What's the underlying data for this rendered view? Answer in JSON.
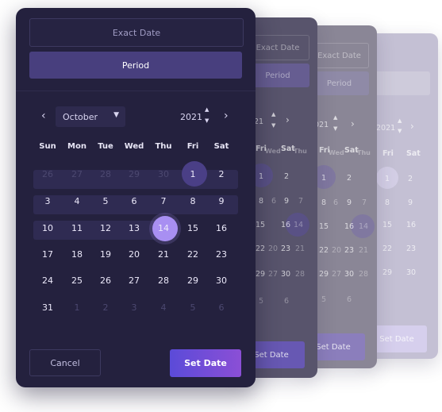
{
  "picker": {
    "tabs": {
      "exact": "Exact Date",
      "period": "Period"
    },
    "month": "October",
    "year": "2021",
    "weekdays": [
      "Sun",
      "Mon",
      "Tue",
      "Wed",
      "Thu",
      "Fri",
      "Sat"
    ],
    "weeks": [
      [
        "26",
        "27",
        "28",
        "29",
        "30",
        "1",
        "2"
      ],
      [
        "3",
        "4",
        "5",
        "6",
        "7",
        "8",
        "9"
      ],
      [
        "10",
        "11",
        "12",
        "13",
        "14",
        "15",
        "16"
      ],
      [
        "17",
        "18",
        "19",
        "20",
        "21",
        "22",
        "23"
      ],
      [
        "24",
        "25",
        "26",
        "27",
        "28",
        "29",
        "30"
      ],
      [
        "31",
        "1",
        "2",
        "3",
        "4",
        "5",
        "6"
      ]
    ],
    "range_start": "1",
    "range_end": "14",
    "cancel_label": "Cancel",
    "set_label": "Set Date"
  },
  "ghosts": {
    "g1": {
      "tab_exact": "Exact Date",
      "tab_period": "Period",
      "year_part": "21",
      "col_fri": "Fri",
      "col_wed": "Wed",
      "col_thu": "Thu",
      "col_sat": "Sat",
      "rows": [
        [
          "2"
        ],
        [
          "9",
          "6",
          "7",
          "9"
        ],
        [
          "15",
          "16",
          "14"
        ],
        [
          "22",
          "23"
        ],
        [
          "29",
          "30"
        ],
        [
          "6"
        ]
      ],
      "set_label": "Set Date"
    },
    "g2": {
      "tab_exact": "Exact Date",
      "tab_period": "Period",
      "year_part": "2021",
      "col_fri": "Fri",
      "col_wed": "Wed",
      "col_thu": "Thu",
      "col_sat": "Sat",
      "set_label": "Set Date"
    },
    "g3": {
      "year_part": "2021",
      "col_fri": "Fri",
      "col_sat": "Sat",
      "set_label": "Set Date"
    }
  },
  "colors": {
    "card_bg": "#24213e",
    "accent_start": "#5b4bd8",
    "accent_end": "#8b4fd6",
    "range_end_bubble": "#a88ff2"
  }
}
